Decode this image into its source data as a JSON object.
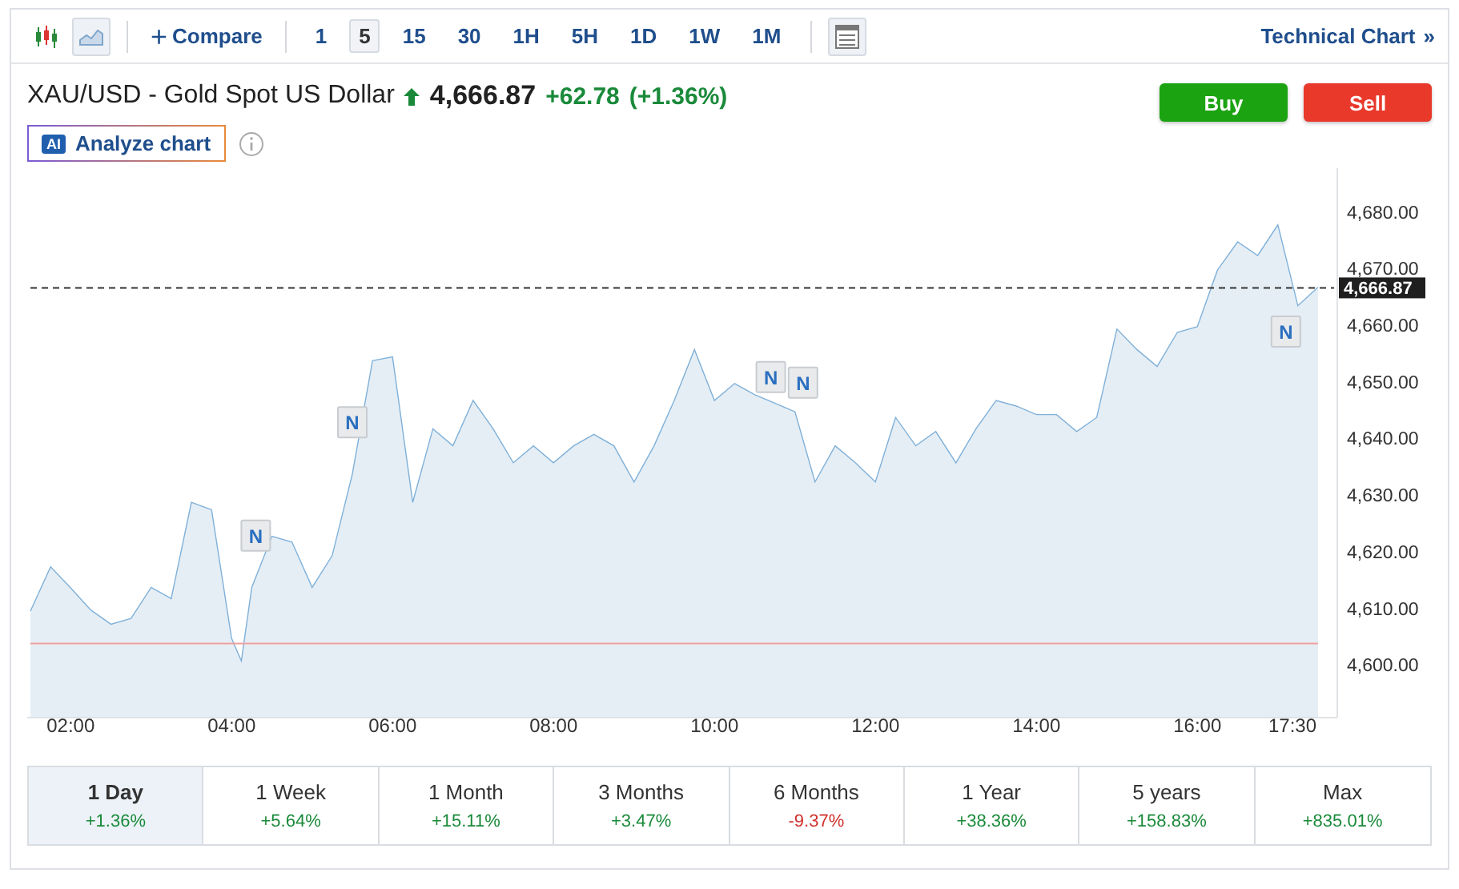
{
  "toolbar": {
    "chart_types": [
      {
        "kind": "candles",
        "selected": false
      },
      {
        "kind": "area",
        "selected": true
      }
    ],
    "compare": {
      "icon": "+",
      "label": "Compare"
    },
    "intervals": [
      {
        "label": "1",
        "selected": false
      },
      {
        "label": "5",
        "selected": true
      },
      {
        "label": "15",
        "selected": false
      },
      {
        "label": "30",
        "selected": false
      },
      {
        "label": "1H",
        "selected": false
      },
      {
        "label": "5H",
        "selected": false
      },
      {
        "label": "1D",
        "selected": false
      },
      {
        "label": "1W",
        "selected": false
      },
      {
        "label": "1M",
        "selected": false
      }
    ],
    "technical_link": {
      "label": "Technical Chart",
      "icon": "»"
    }
  },
  "header": {
    "title": "XAU/USD - Gold Spot US Dollar",
    "price": "4,666.87",
    "change": "+62.78",
    "change_percent": "(+1.36%)",
    "analyze_button": {
      "badge": "AI",
      "label": "Analyze chart"
    },
    "buttons": [
      {
        "label": "Buy",
        "kind": "buy"
      },
      {
        "label": "Sell",
        "kind": "sell"
      }
    ]
  },
  "chart": {
    "chart_data": {
      "type": "area",
      "x": [
        1.5,
        1.75,
        2,
        2.25,
        2.5,
        2.75,
        3,
        3.25,
        3.5,
        3.75,
        4,
        4.12,
        4.25,
        4.5,
        4.75,
        5,
        5.25,
        5.5,
        5.75,
        6,
        6.25,
        6.5,
        6.75,
        7,
        7.25,
        7.5,
        7.75,
        8,
        8.25,
        8.5,
        8.75,
        9,
        9.25,
        9.5,
        9.75,
        10,
        10.25,
        10.5,
        10.75,
        11,
        11.25,
        11.5,
        11.75,
        12,
        12.25,
        12.5,
        12.75,
        13,
        13.25,
        13.5,
        13.75,
        14,
        14.25,
        14.5,
        14.75,
        15,
        15.25,
        15.5,
        15.75,
        16,
        16.25,
        16.5,
        16.75,
        17,
        17.25,
        17.5
      ],
      "series": [
        {
          "color": "#7fb0d8",
          "values": [
            4609.8,
            4617.6,
            4613.9,
            4610,
            4607.5,
            4608.5,
            4614,
            4612,
            4629,
            4627.7,
            4605,
            4601,
            4614,
            4623,
            4622,
            4614,
            4619.6,
            4634,
            4654,
            4654.7,
            4629,
            4642,
            4639,
            4647,
            4642,
            4636,
            4639,
            4636,
            4639,
            4641,
            4639,
            4632.6,
            4639,
            4647,
            4656,
            4647,
            4650,
            4648,
            4646.5,
            4645,
            4632.6,
            4639,
            4636,
            4632.6,
            4644,
            4639,
            4641.5,
            4636,
            4642,
            4647,
            4646,
            4644.5,
            4644.5,
            4641.5,
            4644,
            4659.6,
            4656,
            4653,
            4659,
            4660,
            4670,
            4675,
            4672.6,
            4678,
            4663.7,
            4667
          ]
        }
      ],
      "xlim": [
        1.5,
        17.5
      ],
      "ylim": [
        4591,
        4688
      ],
      "xticks": [
        {
          "value": 2,
          "label": "02:00"
        },
        {
          "value": 4,
          "label": "04:00"
        },
        {
          "value": 6,
          "label": "06:00"
        },
        {
          "value": 8,
          "label": "08:00"
        },
        {
          "value": 10,
          "label": "10:00"
        },
        {
          "value": 12,
          "label": "12:00"
        },
        {
          "value": 14,
          "label": "14:00"
        },
        {
          "value": 16,
          "label": "16:00"
        },
        {
          "value": 17.5,
          "label": "17:30"
        }
      ],
      "yticks": [
        {
          "value": 4600,
          "label": "4,600.00"
        },
        {
          "value": 4610,
          "label": "4,610.00"
        },
        {
          "value": 4620,
          "label": "4,620.00"
        },
        {
          "value": 4630,
          "label": "4,630.00"
        },
        {
          "value": 4640,
          "label": "4,640.00"
        },
        {
          "value": 4650,
          "label": "4,650.00"
        },
        {
          "value": 4660,
          "label": "4,660.00"
        },
        {
          "value": 4670,
          "label": "4,670.00"
        },
        {
          "value": 4680,
          "label": "4,680.00"
        }
      ],
      "ref_lines": [
        {
          "axis": "y",
          "value": 4604.09,
          "color": "#f0a0a0"
        },
        {
          "axis": "y",
          "value": 4666.87,
          "color": "#333333",
          "label": "4,666.87"
        }
      ],
      "annotations": [
        {
          "text": "N",
          "x": 4.3,
          "y": 4623
        },
        {
          "text": "N",
          "x": 5.5,
          "y": 4643
        },
        {
          "text": "N",
          "x": 10.7,
          "y": 4651
        },
        {
          "text": "N",
          "x": 11.1,
          "y": 4650
        },
        {
          "text": "N",
          "x": 17.1,
          "y": 4659
        }
      ]
    }
  },
  "periods": [
    {
      "label": "1 Day",
      "change": "+1.36%",
      "color": "#1a8a3a",
      "selected": true
    },
    {
      "label": "1 Week",
      "change": "+5.64%",
      "color": "#1a8a3a",
      "selected": false
    },
    {
      "label": "1 Month",
      "change": "+15.11%",
      "color": "#1a8a3a",
      "selected": false
    },
    {
      "label": "3 Months",
      "change": "+3.47%",
      "color": "#1a8a3a",
      "selected": false
    },
    {
      "label": "6 Months",
      "change": "-9.37%",
      "color": "#d0312d",
      "selected": false
    },
    {
      "label": "1 Year",
      "change": "+38.36%",
      "color": "#1a8a3a",
      "selected": false
    },
    {
      "label": "5 years",
      "change": "+158.83%",
      "color": "#1a8a3a",
      "selected": false
    },
    {
      "label": "Max",
      "change": "+835.01%",
      "color": "#1a8a3a",
      "selected": false
    }
  ]
}
